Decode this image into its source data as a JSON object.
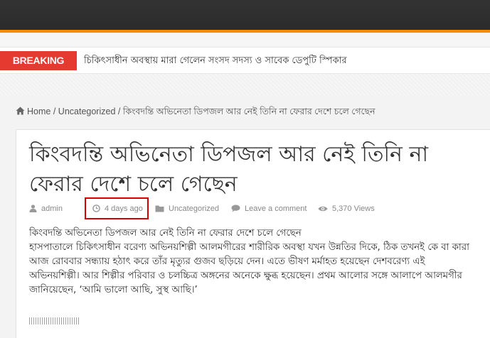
{
  "breaking": {
    "label": "BREAKING NEWS",
    "headline": "চিকিৎসাধীন অবস্থায় মারা গেলেন সংসদ সদস্য ও সাবেক ডেপুটি স্পিকার"
  },
  "breadcrumb": {
    "home": "Home",
    "separator": "/",
    "category": "Uncategorized",
    "current": "কিংবদন্তি অভিনেতা ডিপজল আর নেই তিনি না ফেরার দেশে চলে গেছেন"
  },
  "post": {
    "title": "কিংবদন্তি অভিনেতা ডিপজল আর নেই তিনি না ফেরার দেশে চলে গেছেন",
    "meta": {
      "author": "admin",
      "date": "4 days ago",
      "category": "Uncategorized",
      "comments": "Leave a comment",
      "views": "5,370 Views"
    },
    "paragraph_1": "কিংবদন্তি অভিনেতা ডিপজল আর নেই তিনি না ফেরার দেশে চলে গেছেন",
    "paragraph_2": "হাসপাতালে চিকিৎসাধীন বরেণ্য অভিনয়শিল্পী আলমগীরের শারীরিক অবস্থা যখন উন্নতির দিকে, ঠিক তখনই কে বা কারা আজ রোববার সন্ধ্যায় হঠাৎ করে তাঁর মৃত্যুর গুজব ছড়িয়ে দেন। এতে ভীষণ মর্মাহত হয়েছেন দেশবরেণ্য এই অভিনয়শিল্পী। আর শিল্পীর পরিবার ও চলচ্চিত্র অঙ্গনের অনেকে ক্ষুব্ধ হয়েছেন। প্রথম আলোর সঙ্গে আলাপে আলমগীর জানিয়েছেন, ‘আমি ভালো আছি, সুস্থ আছি।’"
  },
  "icons": {
    "home": "home-icon",
    "author": "user-icon",
    "date": "clock-icon",
    "category": "folder-icon",
    "comments": "comment-icon",
    "views": "eye-icon"
  },
  "colors": {
    "accent": "#f88c00",
    "breaking": "#e43a2f",
    "highlight_box": "#d80000"
  }
}
